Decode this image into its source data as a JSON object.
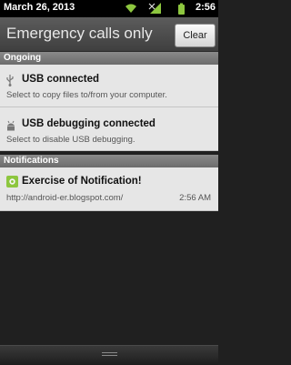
{
  "status_bar": {
    "date": "March 26, 2013",
    "time": "2:56",
    "icons": [
      "wifi-icon",
      "signal-icon",
      "battery-icon"
    ]
  },
  "header": {
    "carrier": "Emergency calls only",
    "clear_label": "Clear"
  },
  "ongoing": {
    "section_label": "Ongoing",
    "items": [
      {
        "icon": "usb-icon",
        "title": "USB connected",
        "subtitle": "Select to copy files to/from your computer."
      },
      {
        "icon": "android-debug-icon",
        "title": "USB debugging connected",
        "subtitle": "Select to disable USB debugging."
      }
    ]
  },
  "notifications": {
    "section_label": "Notifications",
    "items": [
      {
        "icon": "app-icon",
        "title": "Exercise of Notification!",
        "subtitle": "http://android-er.blogspot.com/",
        "time": "2:56 AM"
      }
    ]
  },
  "colors": {
    "status_bar_bg": "#000000",
    "header_bg": "#4e4e4e",
    "item_bg": "#e6e6e6",
    "panel_bg": "#202020",
    "accent_green": "#8dc63f"
  }
}
